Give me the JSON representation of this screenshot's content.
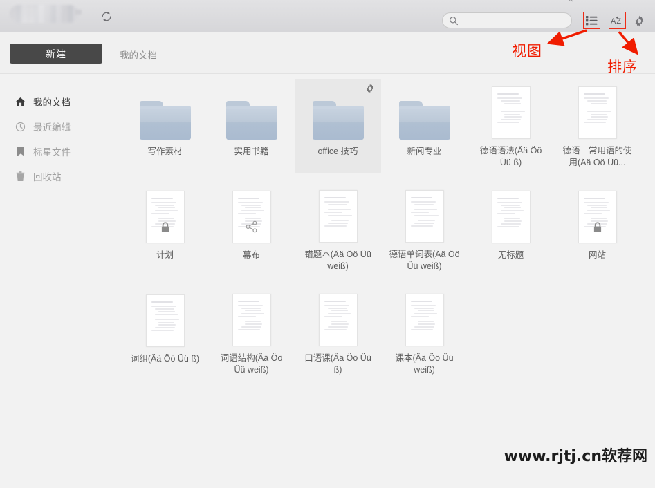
{
  "titlebar": {
    "logo_alt": "blurred-product-logo",
    "refresh_label": "刷新",
    "close_label": "×"
  },
  "actionbar": {
    "new_label": "新建",
    "breadcrumb": "我的文档"
  },
  "search": {
    "value": "",
    "placeholder": ""
  },
  "toolbar_icons": {
    "view": "list-view-icon",
    "sort": "sort-az-icon",
    "settings": "gear-icon"
  },
  "annotations": [
    {
      "id": "view",
      "text": "视图",
      "color": "#f01c00"
    },
    {
      "id": "sort",
      "text": "排序",
      "color": "#f01c00"
    }
  ],
  "sidebar": {
    "items": [
      {
        "label": "我的文档",
        "icon": "home-icon",
        "active": true
      },
      {
        "label": "最近编辑",
        "icon": "clock-icon",
        "active": false
      },
      {
        "label": "标星文件",
        "icon": "bookmark-icon",
        "active": false
      },
      {
        "label": "回收站",
        "icon": "trash-icon",
        "active": false
      }
    ]
  },
  "files": [
    {
      "name": "写作素材",
      "type": "folder",
      "badge": null,
      "selected": false
    },
    {
      "name": "实用书籍",
      "type": "folder",
      "badge": null,
      "selected": false
    },
    {
      "name": "office 技巧",
      "type": "folder",
      "badge": "gear",
      "selected": true
    },
    {
      "name": "新闻专业",
      "type": "folder",
      "badge": null,
      "selected": false
    },
    {
      "name": "德语语法(Ää Öö Üü ß)",
      "type": "document",
      "badge": null,
      "selected": false
    },
    {
      "name": "德语—常用语的使用(Ää Öö Üü...",
      "type": "document",
      "badge": null,
      "selected": false
    },
    {
      "name": "计划",
      "type": "document",
      "badge": "lock",
      "selected": false
    },
    {
      "name": "幕布",
      "type": "document",
      "badge": "share",
      "selected": false
    },
    {
      "name": "错题本(Ää Öö Üü weiß)",
      "type": "document",
      "badge": null,
      "selected": false
    },
    {
      "name": "德语单词表(Ää Öö Üü weiß)",
      "type": "document",
      "badge": null,
      "selected": false
    },
    {
      "name": "无标题",
      "type": "document",
      "badge": null,
      "selected": false
    },
    {
      "name": "网站",
      "type": "document",
      "badge": "lock",
      "selected": false
    },
    {
      "name": "词组(Ää Öö Üü ß)",
      "type": "document",
      "badge": null,
      "selected": false
    },
    {
      "name": "词语结构(Ää Öö Üü weiß)",
      "type": "document",
      "badge": null,
      "selected": false
    },
    {
      "name": "口语课(Ää Öö Üü ß)",
      "type": "document",
      "badge": null,
      "selected": false
    },
    {
      "name": "课本(Ää Öö Üü weiß)",
      "type": "document",
      "badge": null,
      "selected": false
    }
  ],
  "watermark": "www.rjtj.cn软荐网",
  "colors": {
    "accent_annotation": "#f01c00",
    "folder_blue": "#bcc9d8",
    "new_button_bg": "#484848",
    "page_bg": "#f2f2f2"
  }
}
